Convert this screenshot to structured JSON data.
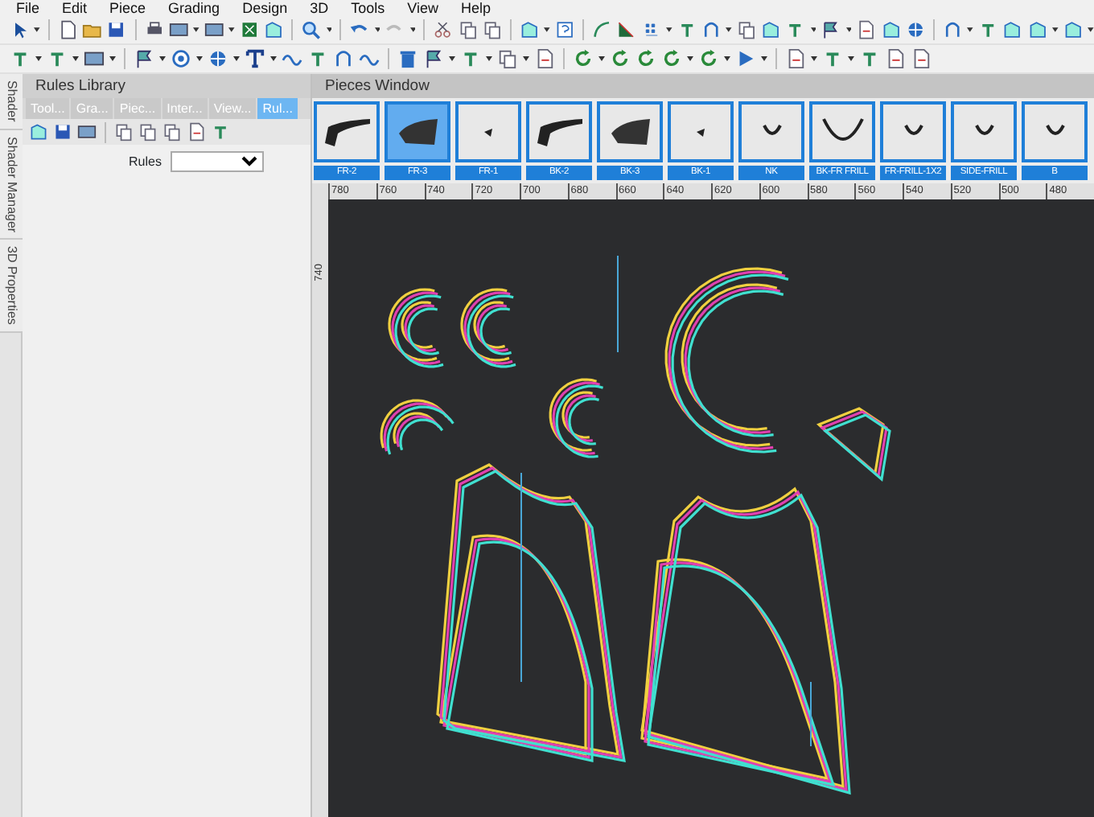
{
  "menu": [
    "File",
    "Edit",
    "Piece",
    "Grading",
    "Design",
    "3D",
    "Tools",
    "View",
    "Help"
  ],
  "side_tabs": [
    "Shader",
    "Shader Manager",
    "3D Properties"
  ],
  "rules_library": {
    "title": "Rules Library",
    "tabs": [
      {
        "label": "Tool...",
        "selected": false
      },
      {
        "label": "Gra...",
        "selected": false
      },
      {
        "label": "Piec...",
        "selected": false
      },
      {
        "label": "Inter...",
        "selected": false
      },
      {
        "label": "View...",
        "selected": false
      },
      {
        "label": "Rul...",
        "selected": true
      }
    ],
    "rules_label": "Rules"
  },
  "pieces_window": {
    "title": "Pieces Window",
    "pieces": [
      {
        "label": "FR-2",
        "selected": false,
        "kind": "sleeve"
      },
      {
        "label": "FR-3",
        "selected": true,
        "kind": "wedge"
      },
      {
        "label": "FR-1",
        "selected": false,
        "kind": "dot"
      },
      {
        "label": "BK-2",
        "selected": false,
        "kind": "sleeve"
      },
      {
        "label": "BK-3",
        "selected": false,
        "kind": "wedge"
      },
      {
        "label": "BK-1",
        "selected": false,
        "kind": "dot"
      },
      {
        "label": "NK",
        "selected": false,
        "kind": "smallcurve"
      },
      {
        "label": "BK-FR FRILL",
        "selected": false,
        "kind": "bigcurve"
      },
      {
        "label": "FR-FRILL-1X2",
        "selected": false,
        "kind": "smallcurve"
      },
      {
        "label": "SIDE-FRILL",
        "selected": false,
        "kind": "smallcurve"
      },
      {
        "label": "B",
        "selected": false,
        "kind": "smallcurve"
      }
    ]
  },
  "ruler": {
    "ticks": [
      "780",
      "760",
      "740",
      "720",
      "700",
      "680",
      "660",
      "640",
      "620",
      "600",
      "580",
      "560",
      "540",
      "520",
      "500",
      "480"
    ],
    "vertical_tick": "740"
  }
}
